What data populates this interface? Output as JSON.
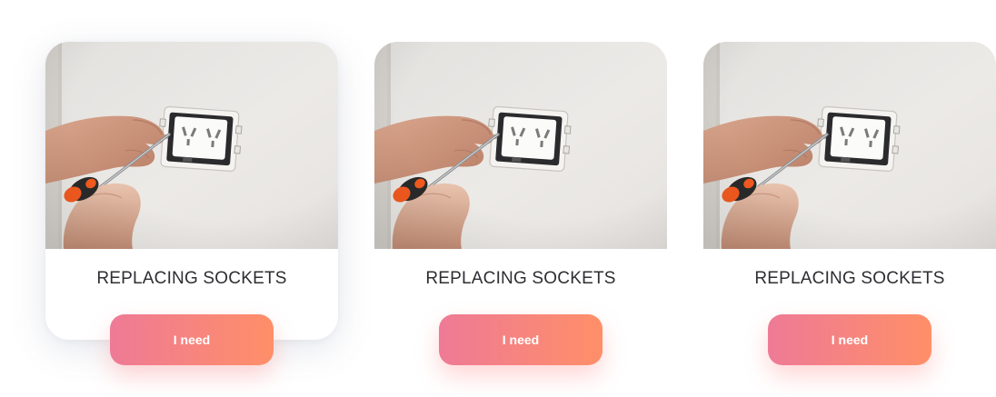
{
  "cards": [
    {
      "title": "REPLACING SOCKETS",
      "button_label": "I need",
      "elevated": true
    },
    {
      "title": "REPLACING SOCKETS",
      "button_label": "I need",
      "elevated": false
    },
    {
      "title": "REPLACING SOCKETS",
      "button_label": "I need",
      "elevated": false
    }
  ],
  "colors": {
    "button_gradient_start": "#ee7a96",
    "button_gradient_end": "#ff8f68",
    "title_text": "#2e2e33",
    "wall": "#e9e7e4"
  },
  "icons": {
    "photo": "socket-replacement-photo"
  }
}
